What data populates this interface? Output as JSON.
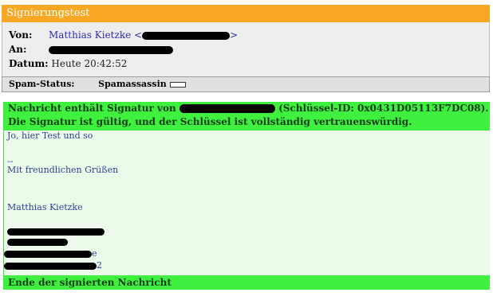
{
  "window": {
    "title": "Signierungstest"
  },
  "header": {
    "from_label": "Von:",
    "from_name": "Matthias Kietzke <",
    "from_suffix": ">",
    "to_label": "An:",
    "date_label": "Datum:",
    "date_value": "Heute 20:42:52"
  },
  "spam": {
    "status_label": "Spam-Status:",
    "filter_label": "Spamassassin"
  },
  "signature": {
    "line1_prefix": "Nachricht enthält Signatur von",
    "line1_suffix": "(Schlüssel-ID: 0x0431D05113F7DC08).",
    "line2": "Die Signatur ist gültig, und der Schlüssel ist vollständig vertrauenswürdig.",
    "end": "Ende der signierten Nachricht"
  },
  "body": {
    "line1": "Jo, hier Test und so",
    "separator": "--",
    "greeting": "Mit freundlichen Grüßen",
    "name": "Matthias Kietzke",
    "trailing_digit": "2",
    "trailing_e": "e"
  },
  "colors": {
    "title_bg": "#f9a825",
    "signature_green": "#3ff03f",
    "body_bg": "#ecfbe9",
    "link_blue": "#2b2bb5"
  }
}
